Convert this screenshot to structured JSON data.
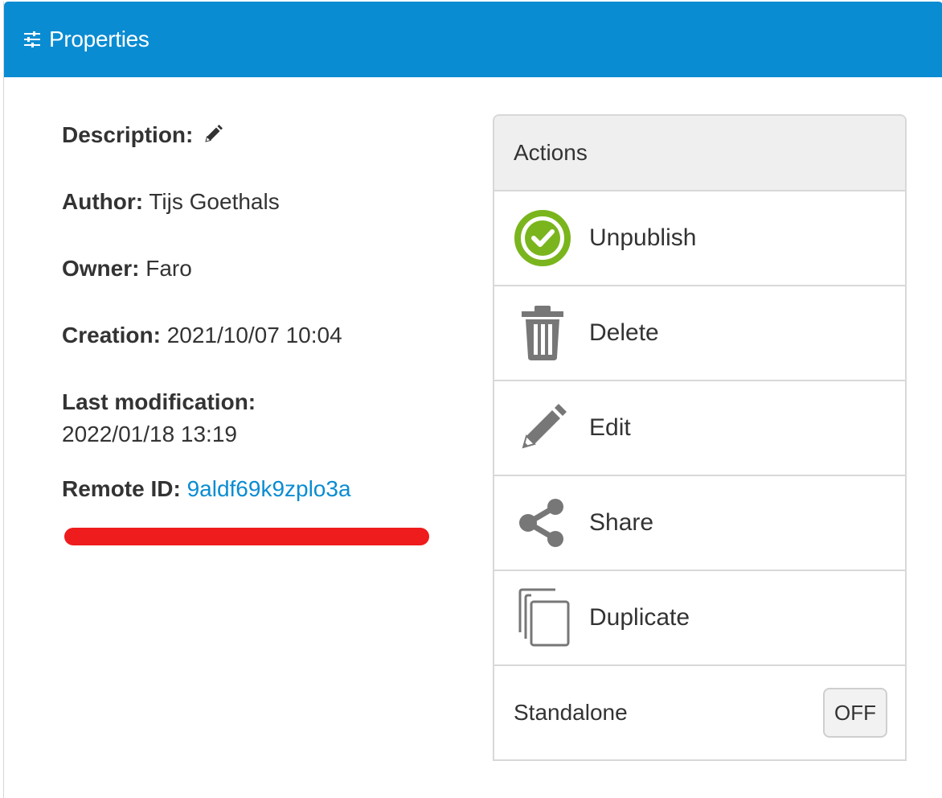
{
  "header": {
    "title": "Properties",
    "icon": "sliders-icon",
    "color": "#0a8cd2"
  },
  "properties": {
    "description_label": "Description:",
    "author_label": "Author:",
    "author_value": "Tijs Goethals",
    "owner_label": "Owner:",
    "owner_value": "Faro",
    "creation_label": "Creation:",
    "creation_value": "2021/10/07 10:04",
    "last_modification_label": "Last modification:",
    "last_modification_value": "2022/01/18 13:19",
    "remote_id_label": "Remote ID:",
    "remote_id_value": "9aldf69k9zplo3a",
    "remote_id_color": "#0a8cd2",
    "highlight_color": "#ee1c1c"
  },
  "actions": {
    "title": "Actions",
    "items": [
      {
        "label": "Unpublish",
        "icon": "check-circle-icon",
        "color": "#7ab51d"
      },
      {
        "label": "Delete",
        "icon": "trash-icon",
        "color": "#777777"
      },
      {
        "label": "Edit",
        "icon": "pencil-icon",
        "color": "#777777"
      },
      {
        "label": "Share",
        "icon": "share-icon",
        "color": "#777777"
      },
      {
        "label": "Duplicate",
        "icon": "copy-icon",
        "color": "#777777"
      }
    ],
    "standalone": {
      "label": "Standalone",
      "toggle_value": "OFF"
    }
  }
}
